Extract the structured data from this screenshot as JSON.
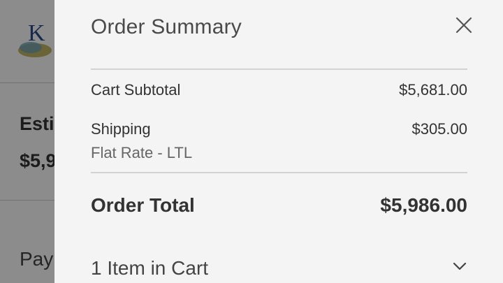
{
  "background": {
    "estimated_label": "Esti",
    "estimated_value": "$5,9",
    "payment_label": "Pay"
  },
  "order_summary": {
    "title": "Order Summary",
    "close_icon": "close-icon",
    "cart_subtotal_label": "Cart Subtotal",
    "cart_subtotal_value": "$5,681.00",
    "shipping_label": "Shipping",
    "shipping_value": "$305.00",
    "shipping_method": "Flat Rate - LTL",
    "order_total_label": "Order Total",
    "order_total_value": "$5,986.00",
    "items_in_cart": "1 Item in Cart",
    "toggle_icon": "chevron-down-icon"
  },
  "colors": {
    "panel_bg": "#f4f4f4",
    "text_primary": "#333333",
    "divider": "#d2d2d2"
  }
}
